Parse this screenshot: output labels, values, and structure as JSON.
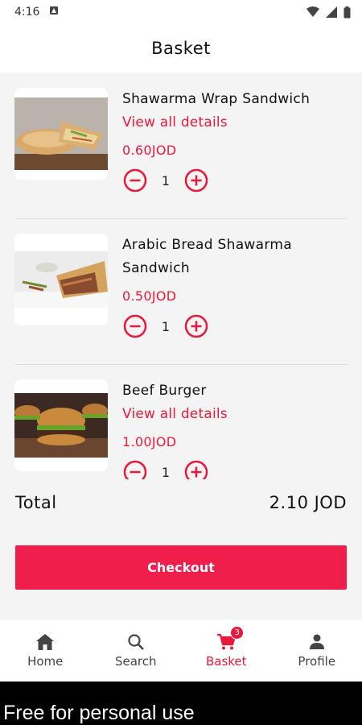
{
  "status_bar": {
    "time": "4:16"
  },
  "header": {
    "title": "Basket"
  },
  "items": [
    {
      "name": "Shawarma Wrap Sandwich",
      "details_link": "View all details",
      "price": "0.60JOD",
      "quantity": "1",
      "image": "shawarma-wrap-photo"
    },
    {
      "name": "Arabic Bread Shawarma Sandwich",
      "price": "0.50JOD",
      "quantity": "1",
      "image": "arabic-bread-shawarma-photo"
    },
    {
      "name": "Beef Burger",
      "details_link": "View all details",
      "price": "1.00JOD",
      "quantity": "1",
      "image": "beef-burger-photo"
    }
  ],
  "summary": {
    "total_label": "Total",
    "total_value": "2.10 JOD"
  },
  "checkout": {
    "label": "Checkout"
  },
  "nav": {
    "home": "Home",
    "search": "Search",
    "basket": "Basket",
    "basket_badge": "3",
    "profile": "Profile"
  },
  "watermark": "Free for personal use",
  "colors": {
    "accent": "#e8193c",
    "checkout": "#f01e4b"
  }
}
